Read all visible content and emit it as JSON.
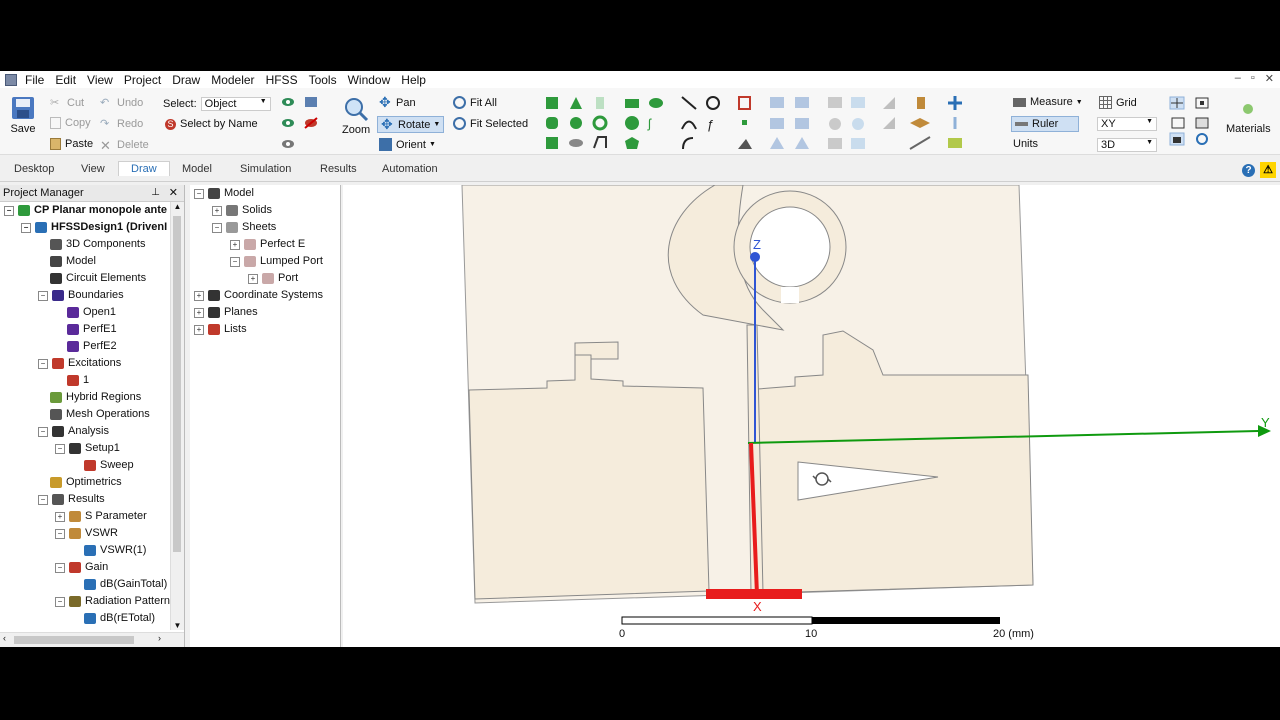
{
  "menu": [
    "File",
    "Edit",
    "View",
    "Project",
    "Draw",
    "Modeler",
    "HFSS",
    "Tools",
    "Window",
    "Help"
  ],
  "window_controls": [
    "–",
    "▫",
    "✕"
  ],
  "ribbon": {
    "save": "Save",
    "cut": "Cut",
    "copy": "Copy",
    "paste": "Paste",
    "undo": "Undo",
    "redo": "Redo",
    "delete": "Delete",
    "select_label": "Select:",
    "select_value": "Object",
    "select_by_name": "Select by Name",
    "zoom": "Zoom",
    "pan": "Pan",
    "rotate": "Rotate",
    "orient": "Orient",
    "fit_all": "Fit All",
    "fit_selected": "Fit Selected",
    "measure": "Measure",
    "ruler": "Ruler",
    "units": "Units",
    "grid": "Grid",
    "plane_value": "XY",
    "dim_value": "3D",
    "materials": "Materials"
  },
  "tabs": [
    {
      "label": "Desktop",
      "active": false
    },
    {
      "label": "View",
      "active": false
    },
    {
      "label": "Draw",
      "active": true
    },
    {
      "label": "Model",
      "active": false
    },
    {
      "label": "Simulation",
      "active": false
    },
    {
      "label": "Results",
      "active": false
    },
    {
      "label": "Automation",
      "active": false
    }
  ],
  "project_manager": {
    "title": "Project Manager",
    "items": [
      {
        "label": "CP Planar monopole ante",
        "level": 0,
        "bold": true,
        "exp": "⊟",
        "icon": "project-icon"
      },
      {
        "label": "HFSSDesign1 (DrivenI",
        "level": 1,
        "bold": true,
        "exp": "⊟",
        "icon": "design-icon"
      },
      {
        "label": "3D Components",
        "level": 2,
        "exp": "",
        "icon": "components-icon"
      },
      {
        "label": "Model",
        "level": 2,
        "exp": "",
        "icon": "model-icon"
      },
      {
        "label": "Circuit Elements",
        "level": 2,
        "exp": "",
        "icon": "circuit-icon"
      },
      {
        "label": "Boundaries",
        "level": 2,
        "exp": "⊟",
        "icon": "boundaries-icon"
      },
      {
        "label": "Open1",
        "level": 3,
        "exp": "",
        "icon": "boundary-icon"
      },
      {
        "label": "PerfE1",
        "level": 3,
        "exp": "",
        "icon": "boundary-icon"
      },
      {
        "label": "PerfE2",
        "level": 3,
        "exp": "",
        "icon": "boundary-icon"
      },
      {
        "label": "Excitations",
        "level": 2,
        "exp": "⊟",
        "icon": "excitations-icon"
      },
      {
        "label": "1",
        "level": 3,
        "exp": "",
        "icon": "port-icon"
      },
      {
        "label": "Hybrid Regions",
        "level": 2,
        "exp": "",
        "icon": "hybrid-icon"
      },
      {
        "label": "Mesh Operations",
        "level": 2,
        "exp": "",
        "icon": "mesh-icon"
      },
      {
        "label": "Analysis",
        "level": 2,
        "exp": "⊟",
        "icon": "analysis-icon"
      },
      {
        "label": "Setup1",
        "level": 3,
        "exp": "⊟",
        "icon": "setup-icon"
      },
      {
        "label": "Sweep",
        "level": 4,
        "exp": "",
        "icon": "sweep-icon"
      },
      {
        "label": "Optimetrics",
        "level": 2,
        "exp": "",
        "icon": "optimetrics-icon"
      },
      {
        "label": "Results",
        "level": 2,
        "exp": "⊟",
        "icon": "results-icon"
      },
      {
        "label": "S Parameter",
        "level": 3,
        "exp": "⊞",
        "icon": "sparam-icon"
      },
      {
        "label": "VSWR",
        "level": 3,
        "exp": "⊟",
        "icon": "vswr-icon"
      },
      {
        "label": "VSWR(1)",
        "level": 4,
        "exp": "",
        "icon": "plot-icon"
      },
      {
        "label": "Gain",
        "level": 3,
        "exp": "⊟",
        "icon": "gain-icon"
      },
      {
        "label": "dB(GainTotal)",
        "level": 4,
        "exp": "",
        "icon": "plot-icon"
      },
      {
        "label": "Radiation Pattern",
        "level": 3,
        "exp": "⊟",
        "icon": "radiation-icon"
      },
      {
        "label": "dB(rETotal)",
        "level": 4,
        "exp": "",
        "icon": "plot-icon"
      }
    ]
  },
  "model_tree": {
    "items": [
      {
        "label": "Model",
        "level": 0,
        "exp": "⊟",
        "icon": "model-icon"
      },
      {
        "label": "Solids",
        "level": 1,
        "exp": "⊞",
        "icon": "solids-icon"
      },
      {
        "label": "Sheets",
        "level": 1,
        "exp": "⊟",
        "icon": "sheets-icon"
      },
      {
        "label": "Perfect E",
        "level": 2,
        "exp": "⊞",
        "icon": "sheet-icon"
      },
      {
        "label": "Lumped Port",
        "level": 2,
        "exp": "⊟",
        "icon": "sheet-icon"
      },
      {
        "label": "Port",
        "level": 3,
        "exp": "⊞",
        "icon": "sheet-icon"
      },
      {
        "label": "Coordinate Systems",
        "level": 0,
        "exp": "⊞",
        "icon": "cs-icon"
      },
      {
        "label": "Planes",
        "level": 0,
        "exp": "⊞",
        "icon": "planes-icon"
      },
      {
        "label": "Lists",
        "level": 0,
        "exp": "⊞",
        "icon": "lists-icon"
      }
    ]
  },
  "viewport": {
    "axis_z": "Z",
    "axis_y": "Y",
    "axis_x": "X",
    "scale_labels": [
      "0",
      "10",
      "20 (mm)"
    ],
    "colors": {
      "substrate": "#f5ecdc",
      "outline": "#8c8c8c",
      "x_axis": "#e81c1c",
      "y_axis": "#0f9a0f",
      "z_axis": "#2f55d4",
      "port": "#e81c1c"
    }
  }
}
